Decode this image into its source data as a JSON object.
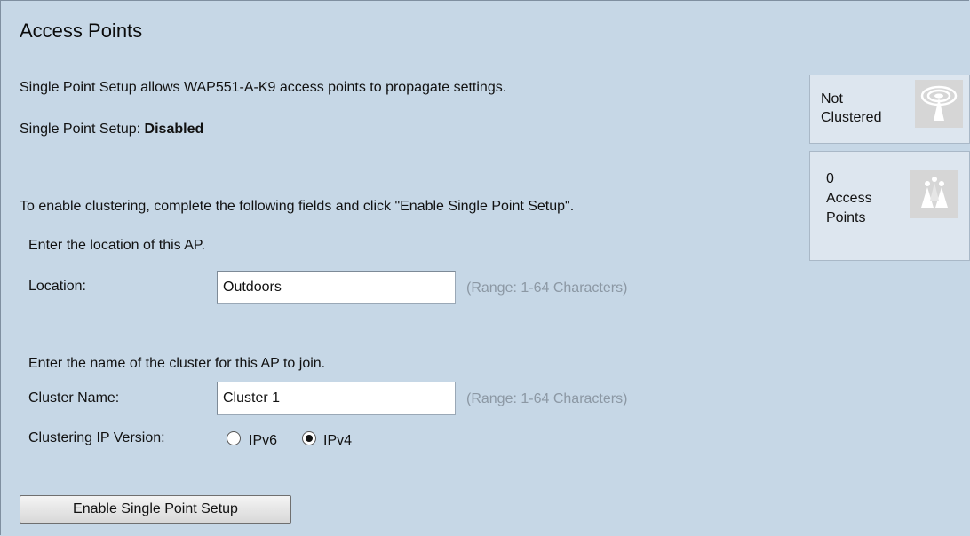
{
  "page": {
    "title": "Access Points",
    "description": "Single Point Setup allows WAP551-A-K9 access points to propagate settings.",
    "status_label": "Single Point Setup:",
    "status_value": "Disabled",
    "instructions": "To enable clustering, complete the following fields and click \"Enable Single Point Setup\"."
  },
  "location": {
    "prompt": "Enter the location of this AP.",
    "label": "Location:",
    "value": "Outdoors",
    "hint": "(Range: 1-64 Characters)"
  },
  "cluster": {
    "prompt": "Enter the name of the cluster for this AP to join.",
    "label": "Cluster Name:",
    "value": "Cluster 1",
    "hint": "(Range: 1-64 Characters)"
  },
  "ip_version": {
    "label": "Clustering IP Version:",
    "options": [
      "IPv6",
      "IPv4"
    ],
    "selected": "IPv4"
  },
  "enable_button": {
    "label": "Enable Single Point Setup"
  },
  "side_panels": {
    "cluster_status": {
      "line1": "Not",
      "line2": "Clustered",
      "icon": "wireless-ap-icon"
    },
    "access_points": {
      "count": "0",
      "line1": "Access",
      "line2": "Points",
      "icon": "access-points-group-icon"
    }
  }
}
